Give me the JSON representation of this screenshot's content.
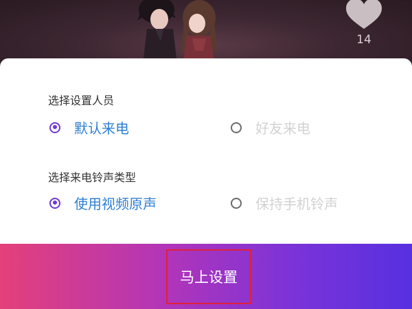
{
  "video": {
    "like_icon": "heart-icon",
    "like_count": "14"
  },
  "settings": {
    "person_section": {
      "title": "选择设置人员",
      "options": [
        {
          "label": "默认来电",
          "selected": true
        },
        {
          "label": "好友来电",
          "selected": false
        }
      ]
    },
    "ringtone_section": {
      "title": "选择来电铃声类型",
      "options": [
        {
          "label": "使用视频原声",
          "selected": true
        },
        {
          "label": "保持手机铃声",
          "selected": false
        }
      ]
    }
  },
  "cta": {
    "label": "马上设置"
  },
  "colors": {
    "accent": "#6f38d8",
    "selected_text": "#2f7fd3",
    "unselected_text": "#d2d2d2",
    "gradient_start": "#e4407a",
    "gradient_end": "#5730e0",
    "highlight_box": "#e0203a"
  }
}
